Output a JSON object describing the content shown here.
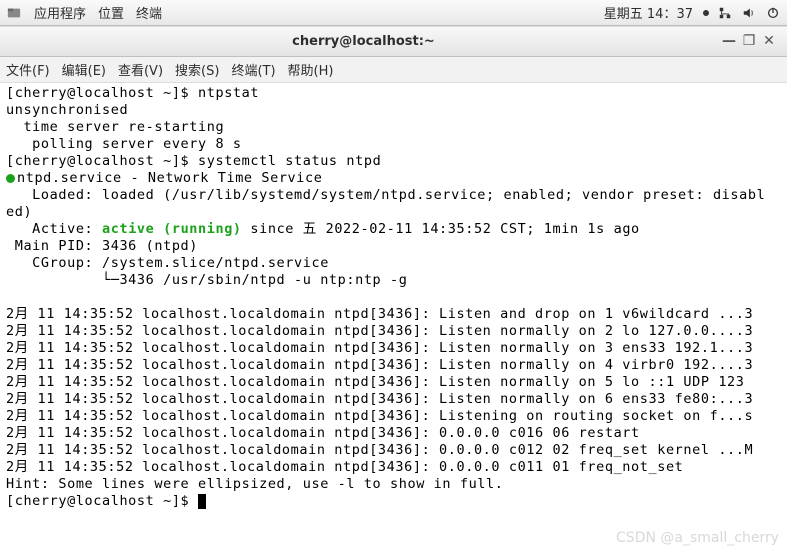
{
  "panel": {
    "menu1": "应用程序",
    "menu2": "位置",
    "menu3": "终端",
    "clock": "星期五 14：37"
  },
  "window": {
    "title": "cherry@localhost:~",
    "min": "—",
    "max": "❐",
    "close": "✕"
  },
  "menubar": {
    "file": "文件(F)",
    "edit": "编辑(E)",
    "view": "查看(V)",
    "search": "搜索(S)",
    "terminal": "终端(T)",
    "help": "帮助(H)"
  },
  "term": {
    "p1": "[cherry@localhost ~]$ ",
    "c1": "ntpstat",
    "l2": "unsynchronised",
    "l3": "  time server re-starting",
    "l4": "   polling server every 8 s",
    "p2": "[cherry@localhost ~]$ ",
    "c2": "systemctl status ntpd",
    "svc": "ntpd.service - Network Time Service",
    "loaded": "   Loaded: loaded (/usr/lib/systemd/system/ntpd.service; enabled; vendor preset: disabl",
    "loaded2": "ed)",
    "active_pre": "   Active: ",
    "active_green": "active (running)",
    "active_post": " since 五 2022-02-11 14:35:52 CST; 1min 1s ago",
    "pid": " Main PID: 3436 (ntpd)",
    "cgroup1": "   CGroup: /system.slice/ntpd.service",
    "cgroup2": "           └─3436 /usr/sbin/ntpd -u ntp:ntp -g",
    "log1": "2月 11 14:35:52 localhost.localdomain ntpd[3436]: Listen and drop on 1 v6wildcard ...3",
    "log2": "2月 11 14:35:52 localhost.localdomain ntpd[3436]: Listen normally on 2 lo 127.0.0....3",
    "log3": "2月 11 14:35:52 localhost.localdomain ntpd[3436]: Listen normally on 3 ens33 192.1...3",
    "log4": "2月 11 14:35:52 localhost.localdomain ntpd[3436]: Listen normally on 4 virbr0 192....3",
    "log5": "2月 11 14:35:52 localhost.localdomain ntpd[3436]: Listen normally on 5 lo ::1 UDP 123",
    "log6": "2月 11 14:35:52 localhost.localdomain ntpd[3436]: Listen normally on 6 ens33 fe80:...3",
    "log7": "2月 11 14:35:52 localhost.localdomain ntpd[3436]: Listening on routing socket on f...s",
    "log8": "2月 11 14:35:52 localhost.localdomain ntpd[3436]: 0.0.0.0 c016 06 restart",
    "log9": "2月 11 14:35:52 localhost.localdomain ntpd[3436]: 0.0.0.0 c012 02 freq_set kernel ...M",
    "log10": "2月 11 14:35:52 localhost.localdomain ntpd[3436]: 0.0.0.0 c011 01 freq_not_set",
    "hint": "Hint: Some lines were ellipsized, use -l to show in full.",
    "p3": "[cherry@localhost ~]$ "
  },
  "watermark": "CSDN @a_small_cherry"
}
